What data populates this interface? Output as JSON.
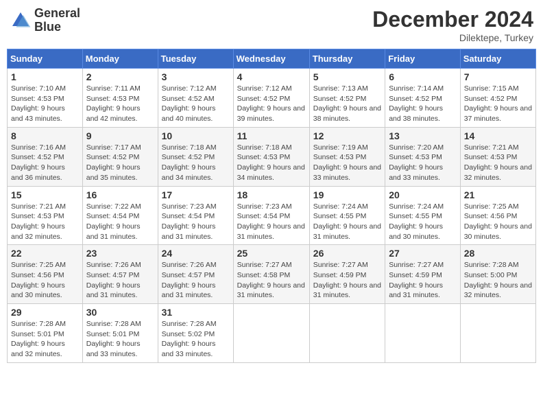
{
  "header": {
    "logo_line1": "General",
    "logo_line2": "Blue",
    "month_title": "December 2024",
    "subtitle": "Dilektepe, Turkey"
  },
  "weekdays": [
    "Sunday",
    "Monday",
    "Tuesday",
    "Wednesday",
    "Thursday",
    "Friday",
    "Saturday"
  ],
  "weeks": [
    [
      {
        "day": "1",
        "sunrise": "7:10 AM",
        "sunset": "4:53 PM",
        "daylight": "9 hours and 43 minutes."
      },
      {
        "day": "2",
        "sunrise": "7:11 AM",
        "sunset": "4:53 PM",
        "daylight": "9 hours and 42 minutes."
      },
      {
        "day": "3",
        "sunrise": "7:12 AM",
        "sunset": "4:52 AM",
        "daylight": "9 hours and 40 minutes."
      },
      {
        "day": "4",
        "sunrise": "7:12 AM",
        "sunset": "4:52 PM",
        "daylight": "9 hours and 39 minutes."
      },
      {
        "day": "5",
        "sunrise": "7:13 AM",
        "sunset": "4:52 PM",
        "daylight": "9 hours and 38 minutes."
      },
      {
        "day": "6",
        "sunrise": "7:14 AM",
        "sunset": "4:52 PM",
        "daylight": "9 hours and 38 minutes."
      },
      {
        "day": "7",
        "sunrise": "7:15 AM",
        "sunset": "4:52 PM",
        "daylight": "9 hours and 37 minutes."
      }
    ],
    [
      {
        "day": "8",
        "sunrise": "7:16 AM",
        "sunset": "4:52 PM",
        "daylight": "9 hours and 36 minutes."
      },
      {
        "day": "9",
        "sunrise": "7:17 AM",
        "sunset": "4:52 PM",
        "daylight": "9 hours and 35 minutes."
      },
      {
        "day": "10",
        "sunrise": "7:18 AM",
        "sunset": "4:52 PM",
        "daylight": "9 hours and 34 minutes."
      },
      {
        "day": "11",
        "sunrise": "7:18 AM",
        "sunset": "4:53 PM",
        "daylight": "9 hours and 34 minutes."
      },
      {
        "day": "12",
        "sunrise": "7:19 AM",
        "sunset": "4:53 PM",
        "daylight": "9 hours and 33 minutes."
      },
      {
        "day": "13",
        "sunrise": "7:20 AM",
        "sunset": "4:53 PM",
        "daylight": "9 hours and 33 minutes."
      },
      {
        "day": "14",
        "sunrise": "7:21 AM",
        "sunset": "4:53 PM",
        "daylight": "9 hours and 32 minutes."
      }
    ],
    [
      {
        "day": "15",
        "sunrise": "7:21 AM",
        "sunset": "4:53 PM",
        "daylight": "9 hours and 32 minutes."
      },
      {
        "day": "16",
        "sunrise": "7:22 AM",
        "sunset": "4:54 PM",
        "daylight": "9 hours and 31 minutes."
      },
      {
        "day": "17",
        "sunrise": "7:23 AM",
        "sunset": "4:54 PM",
        "daylight": "9 hours and 31 minutes."
      },
      {
        "day": "18",
        "sunrise": "7:23 AM",
        "sunset": "4:54 PM",
        "daylight": "9 hours and 31 minutes."
      },
      {
        "day": "19",
        "sunrise": "7:24 AM",
        "sunset": "4:55 PM",
        "daylight": "9 hours and 31 minutes."
      },
      {
        "day": "20",
        "sunrise": "7:24 AM",
        "sunset": "4:55 PM",
        "daylight": "9 hours and 30 minutes."
      },
      {
        "day": "21",
        "sunrise": "7:25 AM",
        "sunset": "4:56 PM",
        "daylight": "9 hours and 30 minutes."
      }
    ],
    [
      {
        "day": "22",
        "sunrise": "7:25 AM",
        "sunset": "4:56 PM",
        "daylight": "9 hours and 30 minutes."
      },
      {
        "day": "23",
        "sunrise": "7:26 AM",
        "sunset": "4:57 PM",
        "daylight": "9 hours and 31 minutes."
      },
      {
        "day": "24",
        "sunrise": "7:26 AM",
        "sunset": "4:57 PM",
        "daylight": "9 hours and 31 minutes."
      },
      {
        "day": "25",
        "sunrise": "7:27 AM",
        "sunset": "4:58 PM",
        "daylight": "9 hours and 31 minutes."
      },
      {
        "day": "26",
        "sunrise": "7:27 AM",
        "sunset": "4:59 PM",
        "daylight": "9 hours and 31 minutes."
      },
      {
        "day": "27",
        "sunrise": "7:27 AM",
        "sunset": "4:59 PM",
        "daylight": "9 hours and 31 minutes."
      },
      {
        "day": "28",
        "sunrise": "7:28 AM",
        "sunset": "5:00 PM",
        "daylight": "9 hours and 32 minutes."
      }
    ],
    [
      {
        "day": "29",
        "sunrise": "7:28 AM",
        "sunset": "5:01 PM",
        "daylight": "9 hours and 32 minutes."
      },
      {
        "day": "30",
        "sunrise": "7:28 AM",
        "sunset": "5:01 PM",
        "daylight": "9 hours and 33 minutes."
      },
      {
        "day": "31",
        "sunrise": "7:28 AM",
        "sunset": "5:02 PM",
        "daylight": "9 hours and 33 minutes."
      },
      null,
      null,
      null,
      null
    ]
  ]
}
